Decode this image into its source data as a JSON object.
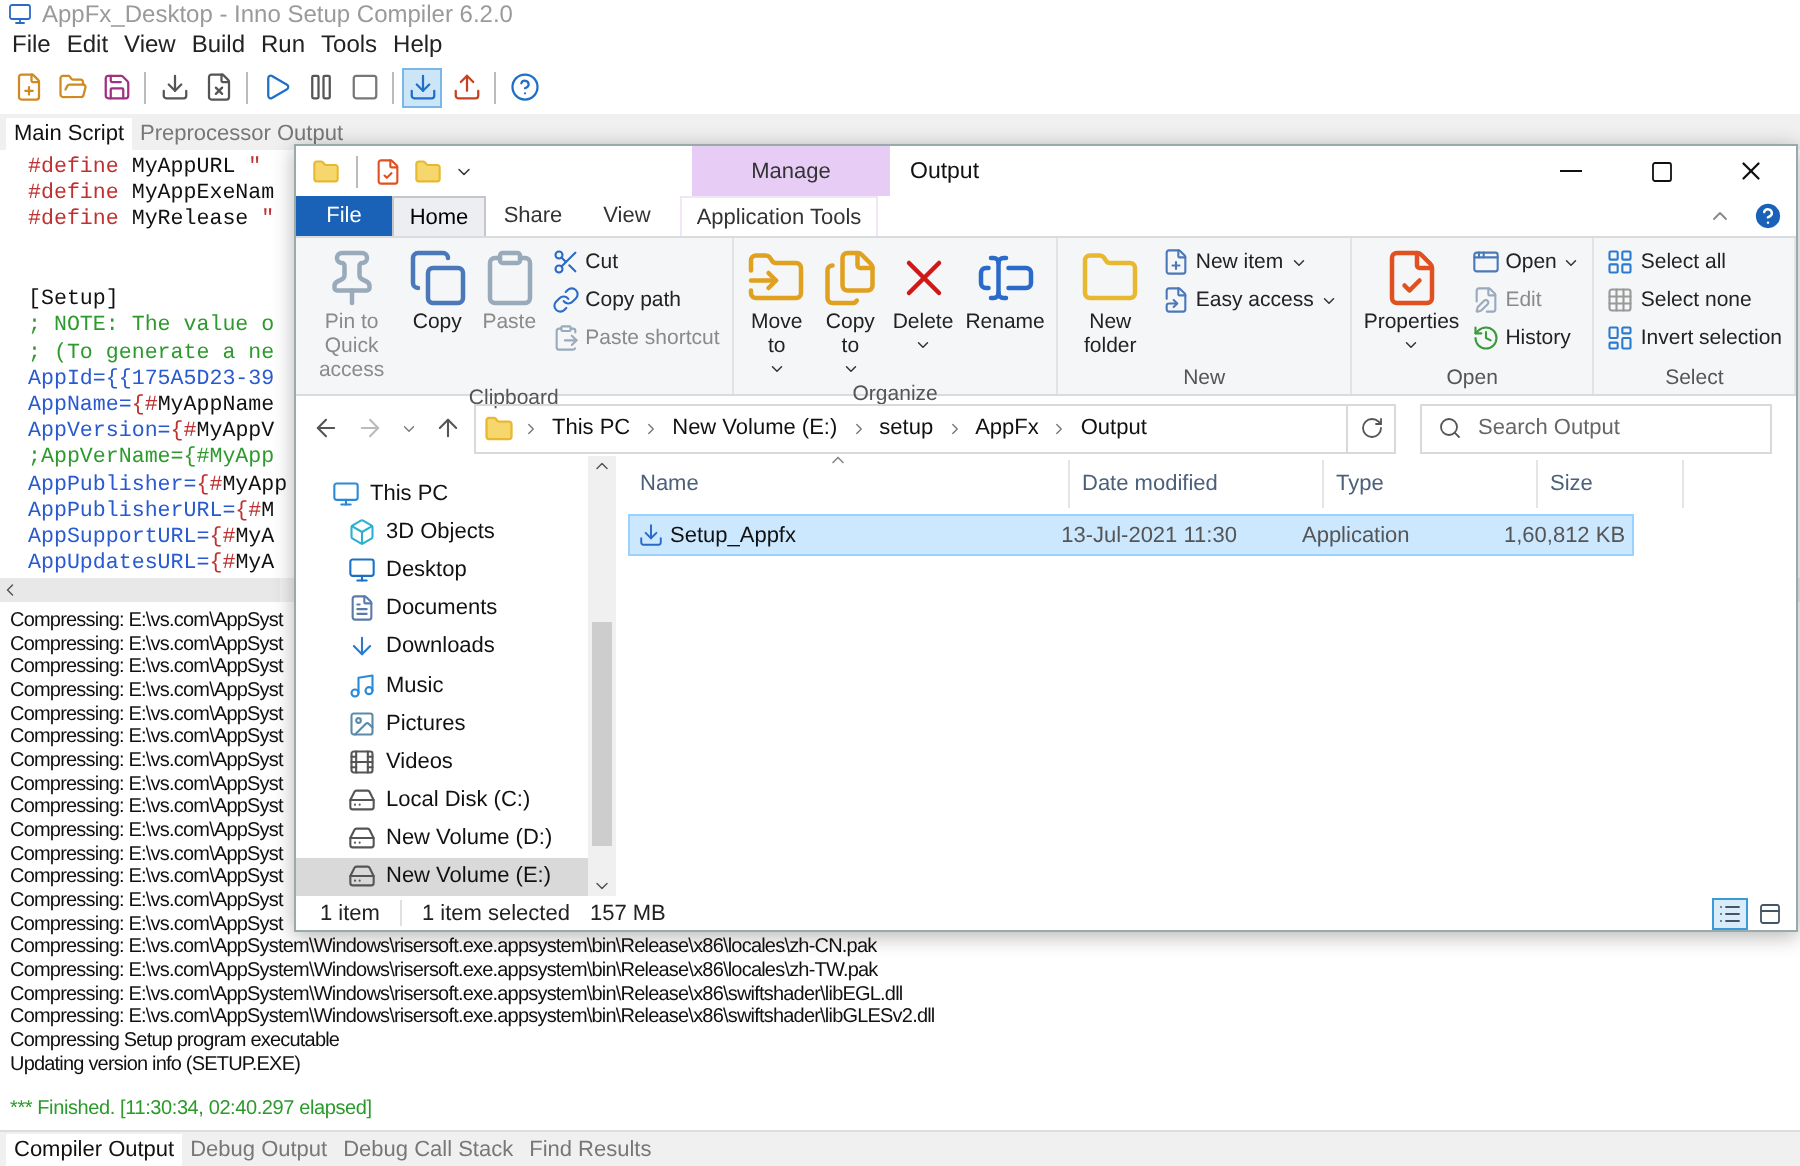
{
  "app": {
    "title": "AppFx_Desktop - Inno Setup Compiler 6.2.0",
    "menu": [
      "File",
      "Edit",
      "View",
      "Build",
      "Run",
      "Tools",
      "Help"
    ],
    "toolbar": [
      {
        "pressed": false
      },
      {
        "pressed": false
      },
      {
        "pressed": false
      },
      {
        "pressed": false
      },
      {
        "pressed": false
      },
      {
        "pressed": false
      },
      {
        "pressed": false
      },
      {
        "pressed": false
      },
      {
        "pressed": true
      },
      {
        "pressed": false
      },
      {
        "pressed": false
      }
    ],
    "editor_tabs": [
      {
        "label": "Main Script",
        "selected": true
      },
      {
        "label": "Preprocessor Output",
        "selected": false
      }
    ],
    "code_lines": [
      {
        "gap_before": false,
        "segments": [
          {
            "kind": "directive",
            "text": "#define"
          },
          {
            "kind": "plain",
            "text": " MyAppURL "
          },
          {
            "kind": "string",
            "text": "\""
          }
        ]
      },
      {
        "gap_before": false,
        "segments": [
          {
            "kind": "directive",
            "text": "#define"
          },
          {
            "kind": "plain",
            "text": " MyAppExeNam"
          }
        ]
      },
      {
        "gap_before": false,
        "segments": [
          {
            "kind": "directive",
            "text": "#define"
          },
          {
            "kind": "plain",
            "text": " MyRelease "
          },
          {
            "kind": "string",
            "text": "\""
          }
        ]
      },
      {
        "gap_before": true,
        "segments": [
          {
            "kind": "plain",
            "text": "[Setup]"
          }
        ]
      },
      {
        "gap_before": false,
        "segments": [
          {
            "kind": "comment",
            "text": "; NOTE: The value o"
          }
        ]
      },
      {
        "gap_before": false,
        "segments": [
          {
            "kind": "comment",
            "text": "; (To generate a ne"
          }
        ]
      },
      {
        "gap_before": false,
        "segments": [
          {
            "kind": "key",
            "text": "AppId={{175A5D23-39"
          }
        ]
      },
      {
        "gap_before": false,
        "segments": [
          {
            "kind": "key",
            "text": "AppName="
          },
          {
            "kind": "directive",
            "text": "{#"
          },
          {
            "kind": "plain",
            "text": "MyAppName"
          }
        ]
      },
      {
        "gap_before": false,
        "segments": [
          {
            "kind": "key",
            "text": "AppVersion="
          },
          {
            "kind": "directive",
            "text": "{#"
          },
          {
            "kind": "plain",
            "text": "MyAppV"
          }
        ]
      },
      {
        "gap_before": false,
        "segments": [
          {
            "kind": "comment",
            "text": ";AppVerName={#MyApp"
          }
        ]
      },
      {
        "gap_before": false,
        "segments": [
          {
            "kind": "key",
            "text": "AppPublisher="
          },
          {
            "kind": "directive",
            "text": "{#"
          },
          {
            "kind": "plain",
            "text": "MyApp"
          }
        ]
      },
      {
        "gap_before": false,
        "segments": [
          {
            "kind": "key",
            "text": "AppPublisherURL="
          },
          {
            "kind": "directive",
            "text": "{#"
          },
          {
            "kind": "plain",
            "text": "M"
          }
        ]
      },
      {
        "gap_before": false,
        "segments": [
          {
            "kind": "key",
            "text": "AppSupportURL="
          },
          {
            "kind": "directive",
            "text": "{#"
          },
          {
            "kind": "plain",
            "text": "MyA"
          }
        ]
      },
      {
        "gap_before": false,
        "segments": [
          {
            "kind": "key",
            "text": "AppUpdatesURL="
          },
          {
            "kind": "directive",
            "text": "{#"
          },
          {
            "kind": "plain",
            "text": "MyA"
          }
        ]
      }
    ],
    "log_lines": [
      "Compressing: E:\\vs.com\\AppSyst",
      "Compressing: E:\\vs.com\\AppSyst",
      "Compressing: E:\\vs.com\\AppSyst",
      "Compressing: E:\\vs.com\\AppSyst",
      "Compressing: E:\\vs.com\\AppSyst",
      "Compressing: E:\\vs.com\\AppSyst",
      "Compressing: E:\\vs.com\\AppSyst",
      "Compressing: E:\\vs.com\\AppSyst",
      "Compressing: E:\\vs.com\\AppSyst",
      "Compressing: E:\\vs.com\\AppSyst",
      "Compressing: E:\\vs.com\\AppSyst",
      "Compressing: E:\\vs.com\\AppSyst",
      "Compressing: E:\\vs.com\\AppSyst",
      "Compressing: E:\\vs.com\\AppSyst",
      "Compressing: E:\\vs.com\\AppSystem\\Windows\\risersoft.exe.appsystem\\bin\\Release\\x86\\locales\\zh-CN.pak",
      "Compressing: E:\\vs.com\\AppSystem\\Windows\\risersoft.exe.appsystem\\bin\\Release\\x86\\locales\\zh-TW.pak",
      "Compressing: E:\\vs.com\\AppSystem\\Windows\\risersoft.exe.appsystem\\bin\\Release\\x86\\swiftshader\\libEGL.dll",
      "Compressing: E:\\vs.com\\AppSystem\\Windows\\risersoft.exe.appsystem\\bin\\Release\\x86\\swiftshader\\libGLESv2.dll",
      "Compressing Setup program executable",
      "Updating version info (SETUP.EXE)"
    ],
    "finished": "*** Finished.  [11:30:34, 02:40.297 elapsed]",
    "bottom_tabs": [
      {
        "label": "Compiler Output",
        "selected": true
      },
      {
        "label": "Debug Output",
        "selected": false
      },
      {
        "label": "Debug Call Stack",
        "selected": false
      },
      {
        "label": "Find Results",
        "selected": false
      }
    ]
  },
  "explorer": {
    "title": "Output",
    "context_tab": "Manage",
    "ribbon_tabs": [
      {
        "label": "File",
        "kind": "file",
        "selected": false
      },
      {
        "label": "Home",
        "kind": "normal",
        "selected": true
      },
      {
        "label": "Share",
        "kind": "normal",
        "selected": false
      },
      {
        "label": "View",
        "kind": "normal",
        "selected": false
      },
      {
        "label": "Application Tools",
        "kind": "contextual",
        "selected": false
      }
    ],
    "ribbon_groups": [
      {
        "label": "Clipboard",
        "commands": [
          {
            "label": "Pin to Quick access",
            "kind": "large",
            "disabled": true,
            "dropdown": false
          },
          {
            "label": "Copy",
            "kind": "large",
            "disabled": false,
            "dropdown": false
          },
          {
            "label": "Paste",
            "kind": "large",
            "disabled": true,
            "dropdown": false
          },
          {
            "label": "Cut",
            "kind": "small",
            "disabled": false,
            "dropdown": false
          },
          {
            "label": "Copy path",
            "kind": "small",
            "disabled": false,
            "dropdown": false
          },
          {
            "label": "Paste shortcut",
            "kind": "small",
            "disabled": true,
            "dropdown": false
          }
        ]
      },
      {
        "label": "Organize",
        "commands": [
          {
            "label": "Move to",
            "kind": "large",
            "disabled": false,
            "dropdown": true
          },
          {
            "label": "Copy to",
            "kind": "large",
            "disabled": false,
            "dropdown": true
          },
          {
            "label": "Delete",
            "kind": "large",
            "disabled": false,
            "dropdown": true
          },
          {
            "label": "Rename",
            "kind": "large",
            "disabled": false,
            "dropdown": false
          }
        ]
      },
      {
        "label": "New",
        "commands": [
          {
            "label": "New folder",
            "kind": "large",
            "disabled": false,
            "dropdown": false
          },
          {
            "label": "New item",
            "kind": "small",
            "disabled": false,
            "dropdown": true
          },
          {
            "label": "Easy access",
            "kind": "small",
            "disabled": false,
            "dropdown": true
          }
        ]
      },
      {
        "label": "Open",
        "commands": [
          {
            "label": "Properties",
            "kind": "large",
            "disabled": false,
            "dropdown": true
          },
          {
            "label": "Open",
            "kind": "small",
            "disabled": false,
            "dropdown": true
          },
          {
            "label": "Edit",
            "kind": "small",
            "disabled": true,
            "dropdown": false
          },
          {
            "label": "History",
            "kind": "small",
            "disabled": false,
            "dropdown": false
          }
        ]
      },
      {
        "label": "Select",
        "commands": [
          {
            "label": "Select all",
            "kind": "small",
            "disabled": false,
            "dropdown": false
          },
          {
            "label": "Select none",
            "kind": "small",
            "disabled": false,
            "dropdown": false
          },
          {
            "label": "Invert selection",
            "kind": "small",
            "disabled": false,
            "dropdown": false
          }
        ]
      }
    ],
    "breadcrumb": [
      "This PC",
      "New Volume (E:)",
      "setup",
      "AppFx",
      "Output"
    ],
    "search": {
      "placeholder": "Search Output"
    },
    "nav_tree": [
      {
        "label": "This PC",
        "selected": false,
        "children": [
          {
            "label": "3D Objects",
            "selected": false
          },
          {
            "label": "Desktop",
            "selected": false
          },
          {
            "label": "Documents",
            "selected": false
          },
          {
            "label": "Downloads",
            "selected": false
          },
          {
            "label": "Music",
            "selected": false
          },
          {
            "label": "Pictures",
            "selected": false
          },
          {
            "label": "Videos",
            "selected": false
          },
          {
            "label": "Local Disk (C:)",
            "selected": false
          },
          {
            "label": "New Volume (D:)",
            "selected": false
          },
          {
            "label": "New Volume (E:)",
            "selected": true
          }
        ]
      }
    ],
    "columns": [
      {
        "label": "Name",
        "sorted": true
      },
      {
        "label": "Date modified",
        "sorted": false
      },
      {
        "label": "Type",
        "sorted": false
      },
      {
        "label": "Size",
        "sorted": false
      }
    ],
    "rows": [
      {
        "cells": [
          "Setup_Appfx",
          "13-Jul-2021 11:30",
          "Application",
          "1,60,812 KB"
        ],
        "selected": true
      }
    ],
    "status": {
      "count": "1 item",
      "selection": "1 item selected",
      "size": "157 MB"
    },
    "views": [
      {
        "kind": "details",
        "selected": true
      },
      {
        "kind": "large_icons",
        "selected": false
      }
    ]
  }
}
